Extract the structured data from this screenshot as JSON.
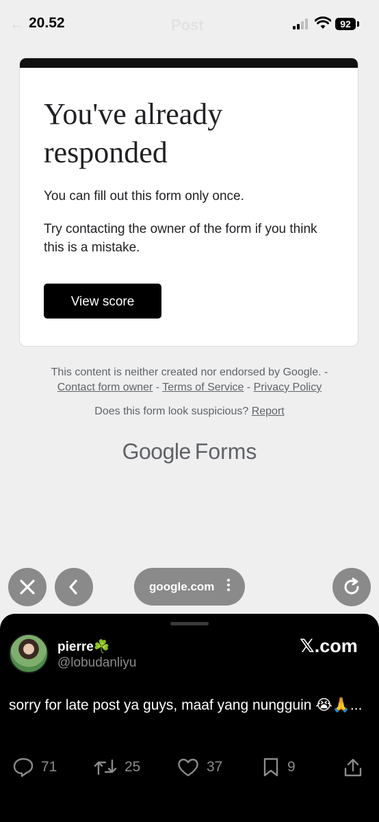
{
  "status_bar": {
    "time": "20.52",
    "ghost_back": "←",
    "ghost_title": "Post",
    "battery": "92"
  },
  "card": {
    "title": "You've already responded",
    "message1": "You can fill out this form only once.",
    "message2": "Try contacting the owner of the form if you think this is a mistake.",
    "button": "View score"
  },
  "footer": {
    "disclaimer": "This content is neither created nor endorsed by Google. -",
    "link_contact": "Contact form owner",
    "separator": " - ",
    "link_terms": "Terms of Service",
    "link_privacy": "Privacy Policy",
    "suspicious": "Does this form look suspicious?",
    "report": "Report",
    "logo_google": "Google",
    "logo_forms": "Forms"
  },
  "browser": {
    "url": "google.com"
  },
  "tweet": {
    "display_name": "pierre☘️",
    "handle": "@lobudanliyu",
    "site": "𝕏.com",
    "text": "sorry for late post ya guys, maaf yang nungguin 😭🙏...",
    "replies": "71",
    "retweets": "25",
    "likes": "37",
    "bookmarks": "9"
  }
}
